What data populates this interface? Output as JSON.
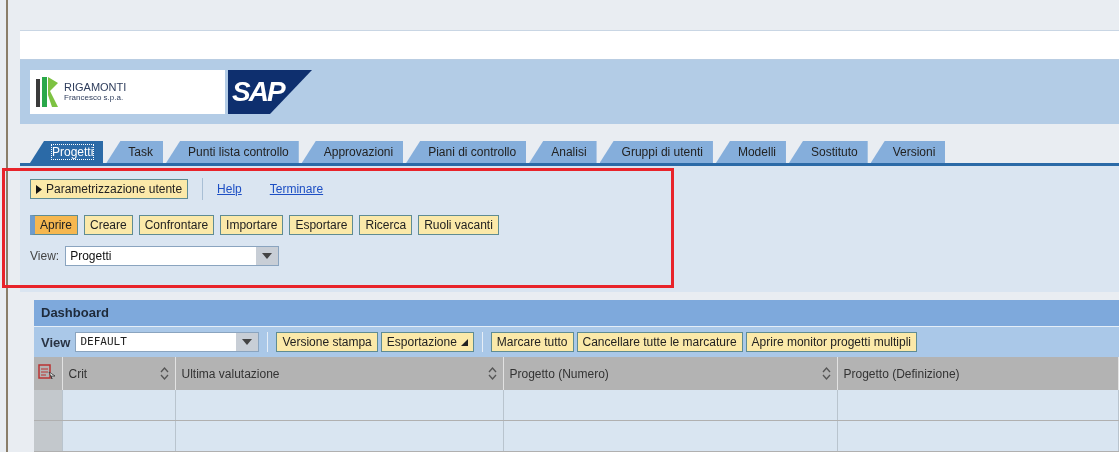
{
  "header": {
    "company_logo": {
      "name": "RIGAMONTI",
      "subtitle": "Francesco s.p.a."
    },
    "product_logo": "SAP"
  },
  "tabs": [
    {
      "label": "Progetti",
      "selected": true
    },
    {
      "label": "Task",
      "selected": false
    },
    {
      "label": "Punti lista controllo",
      "selected": false
    },
    {
      "label": "Approvazioni",
      "selected": false
    },
    {
      "label": "Piani di controllo",
      "selected": false
    },
    {
      "label": "Analisi",
      "selected": false
    },
    {
      "label": "Gruppi di utenti",
      "selected": false
    },
    {
      "label": "Modelli",
      "selected": false
    },
    {
      "label": "Sostituto",
      "selected": false
    },
    {
      "label": "Versioni",
      "selected": false
    }
  ],
  "settings_button": "Parametrizzazione utente",
  "links": [
    "Help",
    "Terminare"
  ],
  "actions": [
    {
      "label": "Aprire",
      "selected": true
    },
    {
      "label": "Creare",
      "selected": false
    },
    {
      "label": "Confrontare",
      "selected": false
    },
    {
      "label": "Importare",
      "selected": false
    },
    {
      "label": "Esportare",
      "selected": false
    },
    {
      "label": "Ricerca",
      "selected": false
    },
    {
      "label": "Ruoli vacanti",
      "selected": false
    }
  ],
  "view": {
    "label": "View:",
    "value": "Progetti"
  },
  "dashboard": {
    "title": "Dashboard",
    "view": {
      "label": "View",
      "value": "DEFAULT"
    },
    "buttons": [
      {
        "label": "Versione stampa",
        "kind": "plain"
      },
      {
        "label": "Esportazione",
        "kind": "menu"
      },
      {
        "label": "Marcare tutto",
        "kind": "plain"
      },
      {
        "label": "Cancellare tutte le marcature",
        "kind": "plain"
      },
      {
        "label": "Aprire monitor progetti multipli",
        "kind": "plain"
      }
    ],
    "columns": [
      {
        "label": "Crit",
        "sortable": true
      },
      {
        "label": "Ultima valutazione",
        "sortable": true
      },
      {
        "label": "Progetto (Numero)",
        "sortable": true
      },
      {
        "label": "Progetto (Definizione)",
        "sortable": false
      }
    ]
  }
}
